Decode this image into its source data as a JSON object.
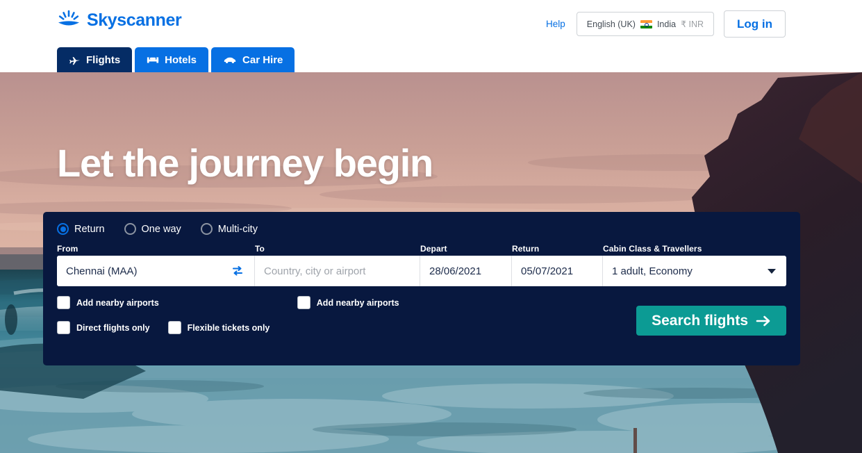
{
  "header": {
    "brand": "Skyscanner",
    "logo_icon": "sunburst-horizon-icon",
    "help_label": "Help",
    "locale": {
      "language": "English (UK)",
      "flag_icon": "india-flag-icon",
      "country": "India",
      "currency": "₹ INR"
    },
    "login_label": "Log in"
  },
  "nav": {
    "tabs": [
      {
        "label": "Flights",
        "icon": "plane-icon",
        "active": true
      },
      {
        "label": "Hotels",
        "icon": "bed-icon",
        "active": false
      },
      {
        "label": "Car Hire",
        "icon": "car-icon",
        "active": false
      }
    ]
  },
  "hero": {
    "title": "Let the journey begin"
  },
  "search": {
    "trip_types": [
      {
        "label": "Return",
        "selected": true
      },
      {
        "label": "One way",
        "selected": false
      },
      {
        "label": "Multi-city",
        "selected": false
      }
    ],
    "labels": {
      "from": "From",
      "to": "To",
      "depart": "Depart",
      "return": "Return",
      "cabin": "Cabin Class & Travellers"
    },
    "fields": {
      "from_value": "Chennai (MAA)",
      "swap_icon": "swap-arrows-icon",
      "to_value": "",
      "to_placeholder": "Country, city or airport",
      "depart_value": "28/06/2021",
      "return_value": "05/07/2021",
      "cabin_value": "1 adult, Economy",
      "cabin_caret_icon": "chevron-down-icon"
    },
    "options": {
      "nearby_from": "Add nearby airports",
      "nearby_to": "Add nearby airports",
      "direct_only": "Direct flights only",
      "flexible_only": "Flexible tickets only"
    },
    "submit_label": "Search flights",
    "submit_icon": "arrow-right-icon"
  },
  "colors": {
    "brand_blue": "#0770e3",
    "tab_active_navy": "#052c65",
    "panel_navy": "#08183f",
    "teal_button": "#0c9b94",
    "sky_pink": "#c99a94",
    "ocean_teal": "#2e7f96",
    "cliff_dark": "#2e1f2a"
  }
}
